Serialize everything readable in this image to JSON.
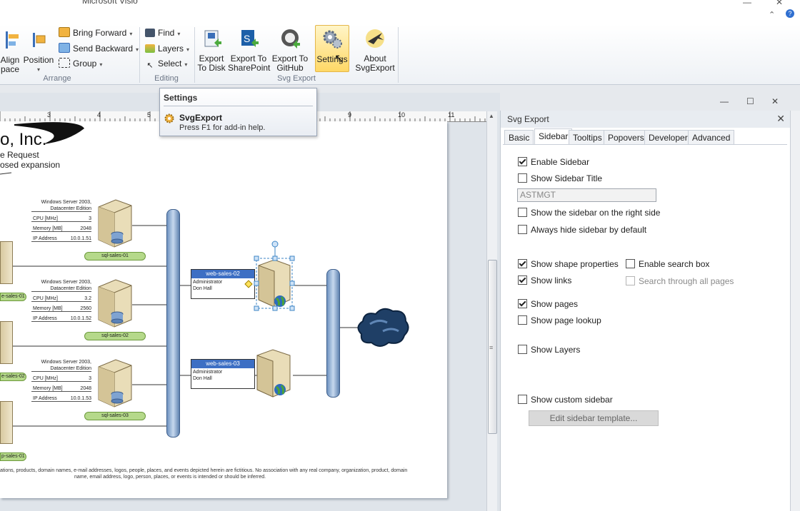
{
  "window": {
    "title": "Microsoft Visio",
    "minimize_label": "—",
    "maximize_label": "☐",
    "close_label": "✕",
    "ribbon_collapse_label": "⌃",
    "help_label": "?"
  },
  "ribbon": {
    "arrange": {
      "label": "Arrange",
      "align_space_label_1": "Align",
      "align_space_label_2": "pace",
      "position_label": "Position",
      "bring_forward": "Bring Forward",
      "send_backward": "Send Backward",
      "group": "Group"
    },
    "editing": {
      "label": "Editing",
      "find": "Find",
      "layers": "Layers",
      "select": "Select"
    },
    "svg_export": {
      "label": "Svg Export",
      "export_disk_1": "Export",
      "export_disk_2": "To Disk",
      "export_sp_1": "Export To",
      "export_sp_2": "SharePoint",
      "export_gh_1": "Export To",
      "export_gh_2": "GitHub",
      "settings": "Settings",
      "about_1": "About",
      "about_2": "SvgExport"
    }
  },
  "tooltip": {
    "title": "Settings",
    "item_name": "SvgExport",
    "help": "Press F1 for add-in help."
  },
  "ruler": {
    "ticks": [
      "3",
      "4",
      "5",
      "9",
      "10",
      "11"
    ]
  },
  "diagram": {
    "company": "o, Inc.",
    "line1": "e Request",
    "line2": "osed expansion",
    "servers": [
      {
        "os1": "Windows Server 2003,",
        "os2": "Datacenter Edition",
        "cpu_l": "CPU [MHz]",
        "cpu_v": "3",
        "mem_l": "Memory [MB]",
        "mem_v": "2048",
        "ip_l": "IP Address",
        "ip_v": "10.0.1.51",
        "name": "sql-sales-01"
      },
      {
        "os1": "Windows Server 2003,",
        "os2": "Datacenter Edition",
        "cpu_l": "CPU [MHz]",
        "cpu_v": "3.2",
        "mem_l": "Memory [MB]",
        "mem_v": "2560",
        "ip_l": "IP Address",
        "ip_v": "10.0.1.52",
        "name": "sql-sales-02"
      },
      {
        "os1": "Windows Server 2003,",
        "os2": "Datacenter Edition",
        "cpu_l": "CPU [MHz]",
        "cpu_v": "3",
        "mem_l": "Memory [MB]",
        "mem_v": "2048",
        "ip_l": "IP Address",
        "ip_v": "10.0.1.53",
        "name": "sql-sales-03"
      }
    ],
    "left_tags": [
      "e-sales-01",
      "e-sales-02",
      "p-sales-01"
    ],
    "web1": {
      "name": "web-sales-02",
      "r1": "Administrator",
      "r2": "Don Hall"
    },
    "web2": {
      "name": "web-sales-03",
      "r1": "Administrator",
      "r2": "Don Hall"
    },
    "footer1": "ations, products, domain names, e-mail addresses, logos, people, places, and events depicted herein are fictitious. No association with any real company, organization, product, domain",
    "footer2": "name, email address, logo, person, places, or events is intended or should be inferred."
  },
  "panel": {
    "title": "Svg Export",
    "close": "✕",
    "tabs": [
      "Basic",
      "Sidebar",
      "Tooltips",
      "Popovers",
      "Developer",
      "Advanced"
    ],
    "active_tab": "Sidebar",
    "enable_sidebar": "Enable Sidebar",
    "show_sidebar_title": "Show Sidebar Title",
    "sidebar_title_value": "ASTMGT",
    "right_side": "Show the sidebar on the right side",
    "always_hide": "Always hide sidebar by default",
    "show_shape_props": "Show shape properties",
    "enable_search": "Enable search box",
    "show_links": "Show links",
    "search_all": "Search through all pages",
    "show_pages": "Show pages",
    "show_page_lookup": "Show page lookup",
    "show_layers": "Show Layers",
    "show_custom_sidebar": "Show custom sidebar",
    "edit_template": "Edit sidebar template..."
  },
  "colors": {
    "accent_highlight": "#ffd866",
    "tag_green": "#b5d98a",
    "header_blue": "#3d6fc4"
  }
}
